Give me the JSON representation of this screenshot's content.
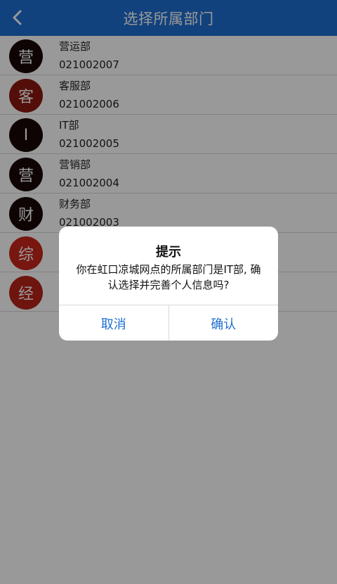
{
  "header": {
    "title": "选择所属部门",
    "bg_color": "#1e6fd0",
    "back_icon": "chevron-left-icon"
  },
  "departments": [
    {
      "avatar": "营",
      "name": "营运部",
      "code": "021002007",
      "avatar_color": "#1a0707"
    },
    {
      "avatar": "客",
      "name": "客服部",
      "code": "021002006",
      "avatar_color": "#8a1810"
    },
    {
      "avatar": "I",
      "name": "IT部",
      "code": "021002005",
      "avatar_color": "#1a0707"
    },
    {
      "avatar": "营",
      "name": "营销部",
      "code": "021002004",
      "avatar_color": "#1a0707"
    },
    {
      "avatar": "财",
      "name": "财务部",
      "code": "021002003",
      "avatar_color": "#1a0707"
    },
    {
      "avatar": "综",
      "name": "",
      "code": "",
      "avatar_color": "#c7271b"
    },
    {
      "avatar": "经",
      "name": "",
      "code": "",
      "avatar_color": "#b8231a"
    }
  ],
  "dialog": {
    "title": "提示",
    "message": "你在虹口凉城网点的所属部门是IT部, 确认选择并完善个人信息吗?",
    "cancel_label": "取消",
    "confirm_label": "确认",
    "button_color": "#1e6fd0"
  }
}
